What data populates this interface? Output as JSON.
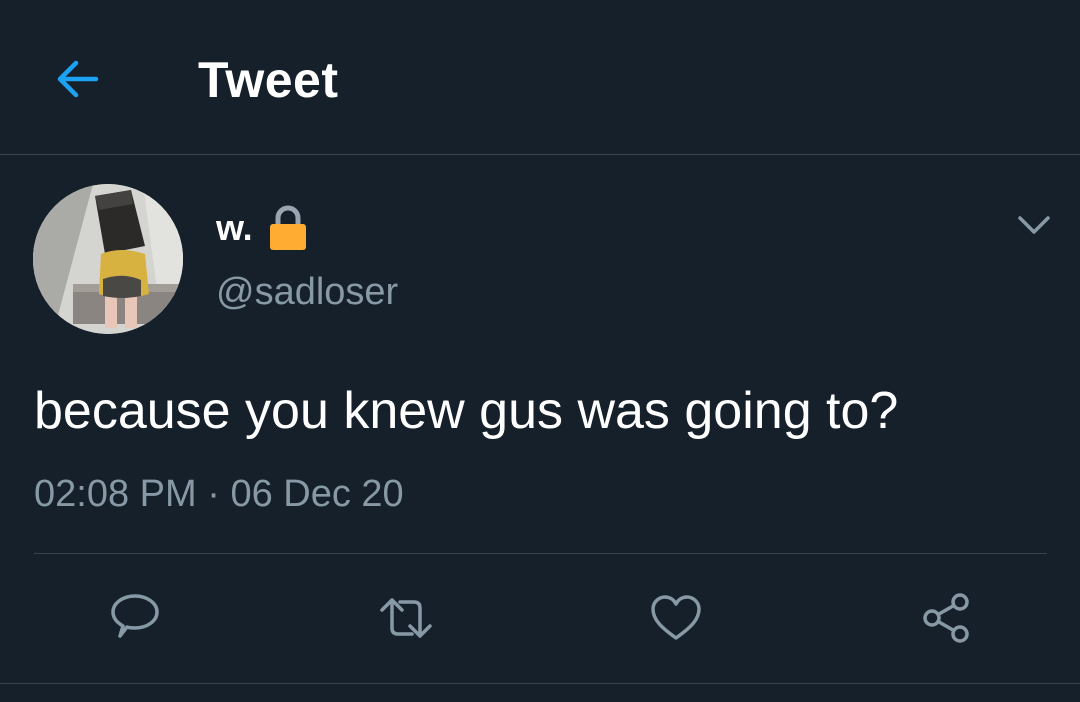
{
  "header": {
    "title": "Tweet",
    "back_icon": "arrow-left-icon"
  },
  "tweet": {
    "author": {
      "display_name": "w.",
      "handle": "@sadloser",
      "protected_icon": "lock-icon",
      "avatar": "avatar"
    },
    "more_icon": "chevron-down-icon",
    "text": "because you knew gus was going to?",
    "time": "02:08 PM",
    "separator": "·",
    "date": "06 Dec 20"
  },
  "actions": [
    {
      "icon": "reply-icon"
    },
    {
      "icon": "retweet-icon"
    },
    {
      "icon": "like-icon"
    },
    {
      "icon": "share-icon"
    }
  ],
  "colors": {
    "background": "#15202b",
    "accent": "#1da1f2",
    "secondary_text": "#8899a6",
    "divider": "#38444d",
    "lock": "#ffac33"
  }
}
